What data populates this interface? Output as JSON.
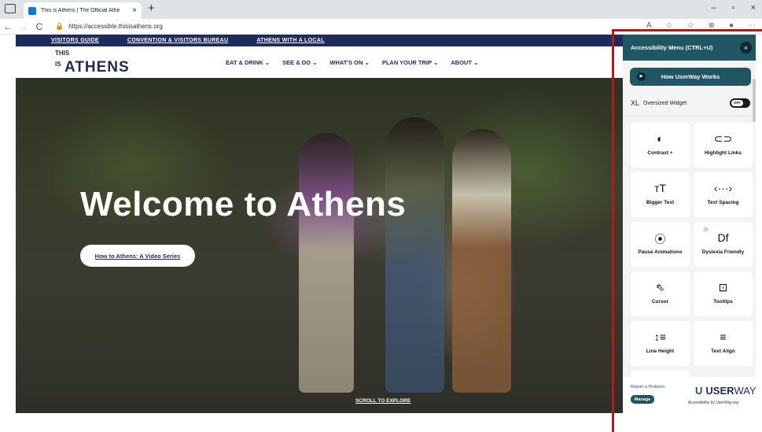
{
  "browser": {
    "tab_title": "This is Athens | The Official Athe",
    "tab_close": "×",
    "new_tab": "+",
    "window_controls": [
      "–",
      "▫",
      "×"
    ],
    "url": "https://accessible.thisisathens.org",
    "nav": {
      "back": "←",
      "forward": "→",
      "reload": "C",
      "lock": "🔒"
    },
    "toolbar_icons": [
      "A",
      "☆",
      "☆",
      "⊕",
      "●",
      "⋯"
    ]
  },
  "site": {
    "top_links": [
      "VISITORS GUIDE",
      "CONVENTION & VISITORS BUREAU",
      "ATHENS WITH A LOCAL"
    ],
    "logo": {
      "small": "THIS",
      "is": "IS",
      "big": "ATHENS"
    },
    "menu": [
      "EAT & DRINK ⌄",
      "SEE & DO ⌄",
      "WHAT'S ON ⌄",
      "PLAN YOUR TRIP ⌄",
      "ABOUT ⌄"
    ],
    "hero_title": "Welcome to Athens",
    "video_button": "How to Athens: A Video Series",
    "scroll_text": "SCROLL TO EXPLORE"
  },
  "a11y": {
    "title": "Accessibility Menu (CTRL+U)",
    "close": "×",
    "how_button": "How UserWay Works",
    "play": "▶",
    "xl_badge": "XL",
    "oversized_label": "Oversized Widget",
    "toggle_state": "OFF",
    "cards": [
      {
        "icon": "◐",
        "label": "Contrast +"
      },
      {
        "icon": "⊂⊃",
        "label": "Highlight Links"
      },
      {
        "icon": "тT",
        "label": "Bigger Text"
      },
      {
        "icon": "‹···›",
        "label": "Text Spacing"
      },
      {
        "icon": "⦿",
        "label": "Pause Animations"
      },
      {
        "icon": "Df",
        "label": "Dyslexia Friendly",
        "badge": "i"
      },
      {
        "icon": "⇖",
        "label": "Cursor"
      },
      {
        "icon": "⊡",
        "label": "Tooltips"
      },
      {
        "icon": "↕≡",
        "label": "Line Height"
      },
      {
        "icon": "≡",
        "label": "Text Align"
      }
    ],
    "report": "Report a Problem",
    "manage": "Manage",
    "brand_u": "U",
    "brand_user": "USER",
    "brand_way": "WAY",
    "accessibility_by": "Accessibility by UserWay.org"
  }
}
